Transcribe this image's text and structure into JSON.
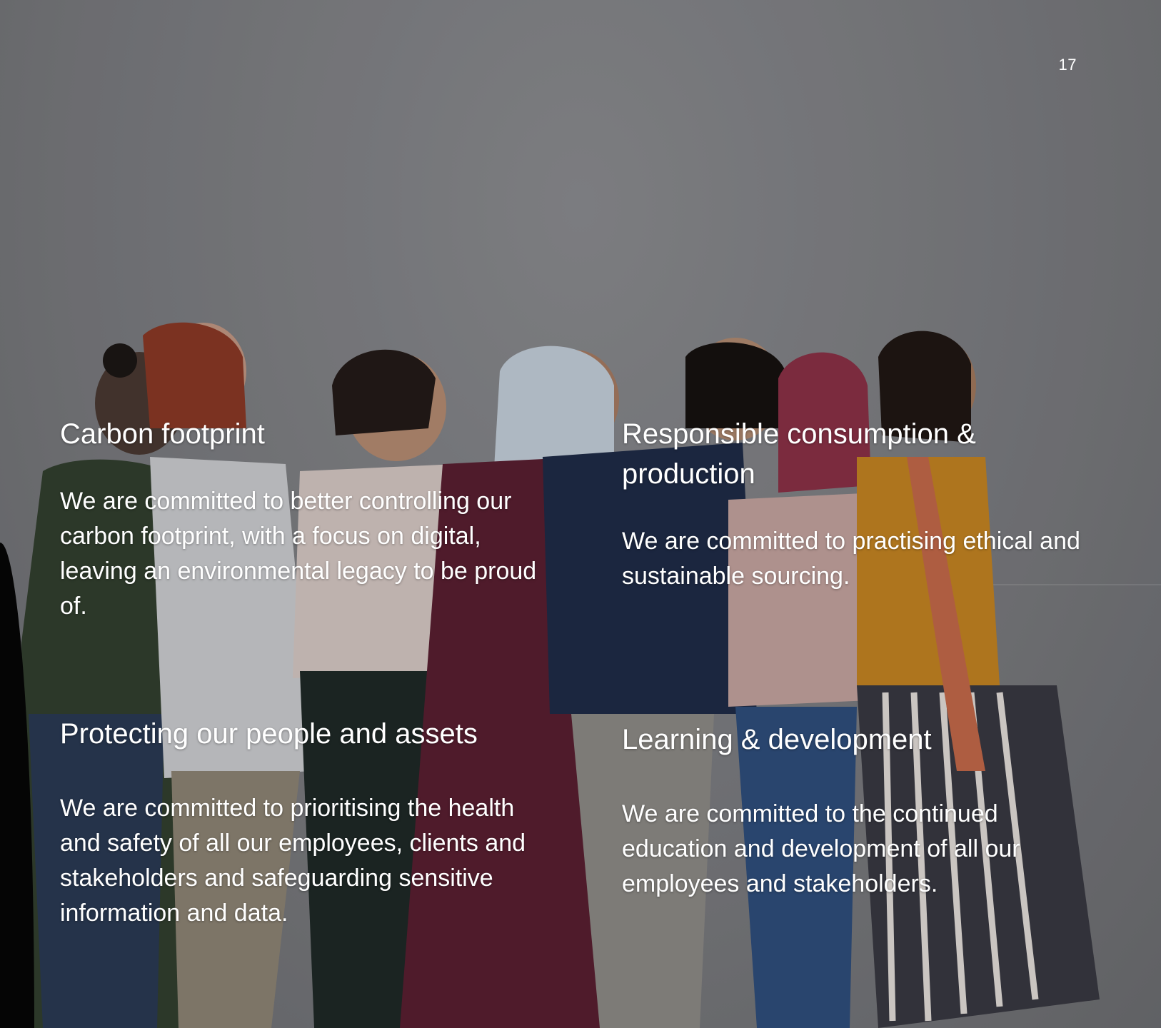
{
  "page": {
    "number": "17"
  },
  "sections": [
    {
      "heading": "Carbon footprint",
      "body": "We are committed to better controlling our carbon footprint, with a focus on digital, leaving an environmental legacy to be proud of."
    },
    {
      "heading": "Responsible consumption & production",
      "body": "We are committed to practising ethical and sustainable sourcing."
    },
    {
      "heading": "Protecting our people and assets",
      "body": "We are committed to prioritising the health and safety of all our employees, clients and stakeholders and safeguarding sensitive information and data."
    },
    {
      "heading": "Learning & development",
      "body": "We are committed to the continued education and development of all our employees and stakeholders."
    }
  ],
  "colors": {
    "text": "#ffffff",
    "wall": "#7d7e82"
  }
}
